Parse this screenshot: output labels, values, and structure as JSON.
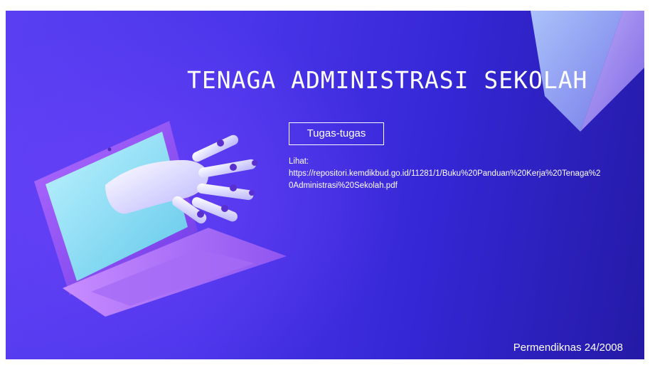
{
  "slide": {
    "title": "TENAGA ADMINISTRASI SEKOLAH",
    "tag_label": "Tugas-tugas",
    "reference_label": "Lihat:",
    "reference_url": "https://repositori.kemdikbud.go.id/11281/1/Buku%20Panduan%20Kerja%20Tenaga%20Administrasi%20Sekolah.pdf",
    "footer": "Permendiknas 24/2008"
  },
  "illustration": {
    "name": "laptop-robot-hand-illustration",
    "decor": "glass-prism-decoration"
  },
  "colors": {
    "background_start": "#5a3ff2",
    "background_end": "#241aa6",
    "text": "#ffffff"
  }
}
